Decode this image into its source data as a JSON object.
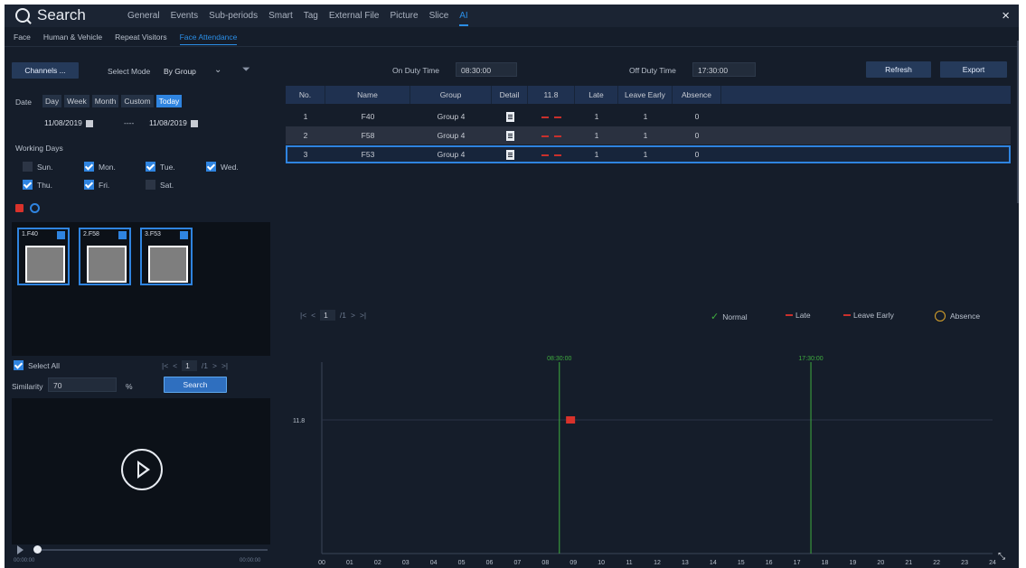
{
  "app": {
    "title": "Search",
    "close_symbol": "×"
  },
  "main_tabs": [
    "General",
    "Events",
    "Sub-periods",
    "Smart",
    "Tag",
    "External File",
    "Picture",
    "Slice",
    "AI"
  ],
  "sub_tabs": [
    "Face",
    "Human & Vehicle",
    "Repeat Visitors",
    "Face Attendance"
  ],
  "left": {
    "channels_btn": "Channels ...",
    "select_mode_label": "Select Mode",
    "select_mode_value": "By Group",
    "date_label": "Date",
    "date_tabs": [
      "Day",
      "Week",
      "Month",
      "Custom",
      "Today"
    ],
    "date_from": "11/08/2019",
    "date_sep": "----",
    "date_to": "11/08/2019",
    "working_days_label": "Working Days",
    "days": [
      {
        "label": "Sun.",
        "checked": false
      },
      {
        "label": "Mon.",
        "checked": true
      },
      {
        "label": "Tue.",
        "checked": true
      },
      {
        "label": "Wed.",
        "checked": true
      },
      {
        "label": "Thu.",
        "checked": true
      },
      {
        "label": "Fri.",
        "checked": true
      },
      {
        "label": "Sat.",
        "checked": false
      }
    ],
    "thumbs": [
      "1.F40",
      "2.F58",
      "3.F53"
    ],
    "select_all_label": "Select All",
    "page_current": "1",
    "page_total": "/1",
    "similarity_label": "Similarity",
    "similarity_value": "70",
    "percent": "%",
    "search_btn": "Search",
    "time_start": "00:00:00",
    "time_end": "00:00:00"
  },
  "right": {
    "on_duty_label": "On Duty Time",
    "on_duty_value": "08:30:00",
    "off_duty_label": "Off Duty Time",
    "off_duty_value": "17:30:00",
    "refresh_btn": "Refresh",
    "export_btn": "Export",
    "columns": [
      "No.",
      "Name",
      "Group",
      "Detail",
      "11.8",
      "Late",
      "Leave Early",
      "Absence"
    ],
    "rows": [
      {
        "no": "1",
        "name": "F40",
        "group": "Group 4",
        "late": "1",
        "leave_early": "1",
        "absence": "0"
      },
      {
        "no": "2",
        "name": "F58",
        "group": "Group 4",
        "late": "1",
        "leave_early": "1",
        "absence": "0"
      },
      {
        "no": "3",
        "name": "F53",
        "group": "Group 4",
        "late": "1",
        "leave_early": "1",
        "absence": "0"
      }
    ],
    "page_current": "1",
    "page_total": "/1",
    "legend": [
      "Normal",
      "Late",
      "Leave Early",
      "Absence"
    ],
    "colors": {
      "normal": "#3fae3f",
      "late": "#d9322b",
      "absence": "#d9a32b",
      "accent": "#2f84e0"
    }
  },
  "chart_data": {
    "type": "timeline",
    "y_category": "11.8",
    "x_ticks": [
      "00",
      "01",
      "02",
      "03",
      "04",
      "05",
      "06",
      "07",
      "08",
      "09",
      "10",
      "11",
      "12",
      "13",
      "14",
      "15",
      "16",
      "17",
      "18",
      "19",
      "20",
      "21",
      "22",
      "23",
      "24"
    ],
    "markers": [
      {
        "label": "08:30:00",
        "hour": 8.5
      },
      {
        "label": "17:30:00",
        "hour": 17.5
      }
    ],
    "events": [
      {
        "category": "11.8",
        "hour": 8.9,
        "status": "Late"
      }
    ]
  }
}
